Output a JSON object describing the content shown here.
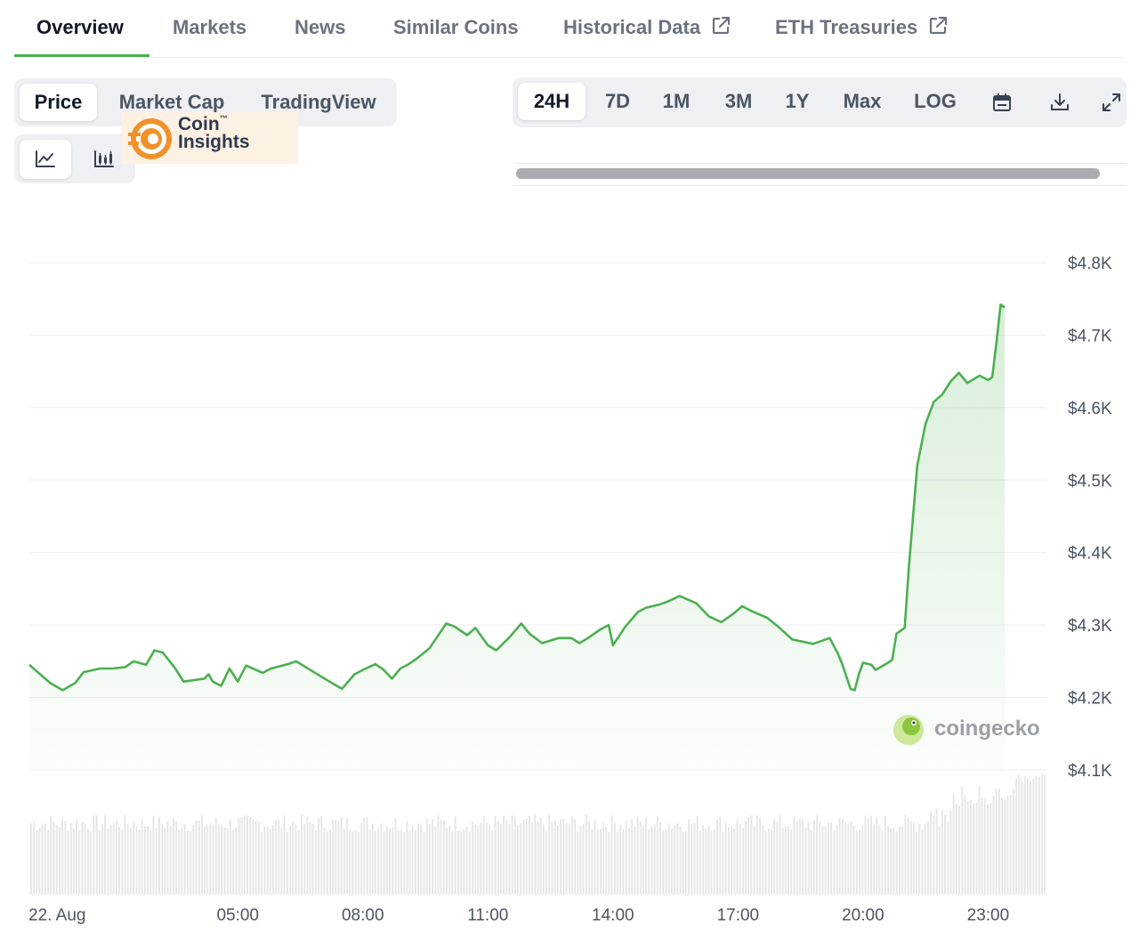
{
  "nav": {
    "tabs": [
      {
        "label": "Overview",
        "active": true
      },
      {
        "label": "Markets"
      },
      {
        "label": "News"
      },
      {
        "label": "Similar Coins"
      },
      {
        "label": "Historical Data",
        "external": true
      },
      {
        "label": "ETH Treasuries",
        "external": true
      }
    ]
  },
  "chart_type_tabs": {
    "items": [
      "Price",
      "Market Cap",
      "TradingView"
    ],
    "active": "Price"
  },
  "chart_style": {
    "options": [
      "line-chart-icon",
      "candlestick-icon"
    ],
    "active": "line-chart-icon"
  },
  "range_tabs": {
    "items": [
      "24H",
      "7D",
      "1M",
      "3M",
      "1Y",
      "Max",
      "LOG"
    ],
    "active": "24H",
    "icons": [
      "calendar-icon",
      "download-icon",
      "expand-icon"
    ]
  },
  "watermarks": {
    "coin_insights": {
      "line1": "Coin",
      "tm": "™",
      "line2": "Insights"
    },
    "coingecko": "coingecko"
  },
  "colors": {
    "accent": "#4caf50",
    "line": "#4caf50",
    "logo_orange": "#f0912a"
  },
  "chart_data": {
    "type": "area",
    "y_ticks": [
      "$4.8K",
      "$4.7K",
      "$4.6K",
      "$4.5K",
      "$4.4K",
      "$4.3K",
      "$4.2K",
      "$4.1K"
    ],
    "ylim": [
      4100,
      4800
    ],
    "x_ticks": [
      "22. Aug",
      "05:00",
      "08:00",
      "11:00",
      "14:00",
      "17:00",
      "20:00",
      "23:00"
    ],
    "x_tick_hours": [
      0,
      5,
      8,
      11,
      14,
      17,
      20,
      23
    ],
    "x_range_hours": [
      0,
      24.4
    ],
    "grid": true,
    "series": [
      {
        "points": [
          [
            0.0,
            4245
          ],
          [
            0.5,
            4220
          ],
          [
            0.8,
            4210
          ],
          [
            1.1,
            4220
          ],
          [
            1.3,
            4235
          ],
          [
            1.7,
            4240
          ],
          [
            2.0,
            4240
          ],
          [
            2.3,
            4242
          ],
          [
            2.5,
            4250
          ],
          [
            2.8,
            4245
          ],
          [
            3.0,
            4265
          ],
          [
            3.2,
            4262
          ],
          [
            3.5,
            4240
          ],
          [
            3.7,
            4222
          ],
          [
            4.2,
            4226
          ],
          [
            4.3,
            4232
          ],
          [
            4.4,
            4222
          ],
          [
            4.6,
            4216
          ],
          [
            4.8,
            4240
          ],
          [
            5.0,
            4222
          ],
          [
            5.2,
            4244
          ],
          [
            5.6,
            4234
          ],
          [
            5.8,
            4240
          ],
          [
            6.2,
            4246
          ],
          [
            6.4,
            4250
          ],
          [
            6.8,
            4236
          ],
          [
            7.2,
            4222
          ],
          [
            7.5,
            4212
          ],
          [
            7.8,
            4232
          ],
          [
            8.0,
            4238
          ],
          [
            8.3,
            4246
          ],
          [
            8.5,
            4238
          ],
          [
            8.7,
            4226
          ],
          [
            8.9,
            4240
          ],
          [
            9.1,
            4246
          ],
          [
            9.3,
            4254
          ],
          [
            9.6,
            4268
          ],
          [
            10.0,
            4302
          ],
          [
            10.2,
            4298
          ],
          [
            10.5,
            4286
          ],
          [
            10.7,
            4296
          ],
          [
            11.0,
            4272
          ],
          [
            11.2,
            4265
          ],
          [
            11.5,
            4282
          ],
          [
            11.8,
            4302
          ],
          [
            12.0,
            4288
          ],
          [
            12.3,
            4275
          ],
          [
            12.7,
            4282
          ],
          [
            13.0,
            4282
          ],
          [
            13.2,
            4275
          ],
          [
            13.4,
            4282
          ],
          [
            13.7,
            4294
          ],
          [
            13.9,
            4300
          ],
          [
            14.0,
            4272
          ],
          [
            14.3,
            4298
          ],
          [
            14.6,
            4318
          ],
          [
            14.8,
            4324
          ],
          [
            15.1,
            4328
          ],
          [
            15.3,
            4332
          ],
          [
            15.6,
            4340
          ],
          [
            16.0,
            4330
          ],
          [
            16.3,
            4312
          ],
          [
            16.6,
            4304
          ],
          [
            16.9,
            4316
          ],
          [
            17.1,
            4326
          ],
          [
            17.3,
            4320
          ],
          [
            17.7,
            4310
          ],
          [
            18.0,
            4296
          ],
          [
            18.3,
            4280
          ],
          [
            18.8,
            4274
          ],
          [
            19.2,
            4282
          ],
          [
            19.4,
            4260
          ],
          [
            19.5,
            4246
          ],
          [
            19.7,
            4212
          ],
          [
            19.8,
            4210
          ],
          [
            19.9,
            4232
          ],
          [
            20.0,
            4248
          ],
          [
            20.2,
            4245
          ],
          [
            20.3,
            4238
          ],
          [
            20.6,
            4248
          ],
          [
            20.7,
            4252
          ],
          [
            20.8,
            4288
          ],
          [
            21.0,
            4296
          ],
          [
            21.1,
            4380
          ],
          [
            21.3,
            4520
          ],
          [
            21.5,
            4578
          ],
          [
            21.7,
            4608
          ],
          [
            21.9,
            4618
          ],
          [
            22.1,
            4636
          ],
          [
            22.3,
            4648
          ],
          [
            22.5,
            4634
          ],
          [
            22.8,
            4644
          ],
          [
            23.0,
            4638
          ],
          [
            23.1,
            4642
          ],
          [
            23.2,
            4690
          ],
          [
            23.3,
            4742
          ],
          [
            23.4,
            4738
          ]
        ]
      }
    ]
  }
}
